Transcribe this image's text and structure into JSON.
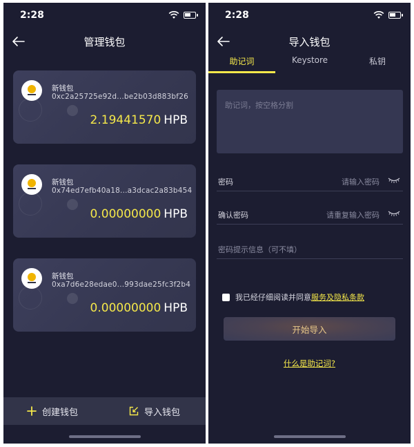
{
  "status_bar": {
    "time": "2:28"
  },
  "left_screen": {
    "title": "管理钱包",
    "wallets": [
      {
        "name": "新钱包",
        "address": "0xc2a25725e92d...be2b03d883bf26",
        "balance": "2.19441570",
        "unit": "HPB"
      },
      {
        "name": "新钱包",
        "address": "0x74ed7efb40a18...a3dcac2a83b454",
        "balance": "0.00000000",
        "unit": "HPB"
      },
      {
        "name": "新钱包",
        "address": "0xa7d6e28edae0...993dae25fc3f2b4",
        "balance": "0.00000000",
        "unit": "HPB"
      }
    ],
    "bottom_bar": {
      "create_label": "创建钱包",
      "import_label": "导入钱包"
    }
  },
  "right_screen": {
    "title": "导入钱包",
    "tabs": [
      {
        "label": "助记词",
        "active": true
      },
      {
        "label": "Keystore",
        "active": false
      },
      {
        "label": "私钥",
        "active": false
      }
    ],
    "mnemonic_placeholder": "助记词，按空格分割",
    "password": {
      "label": "密码",
      "placeholder": "请输入密码"
    },
    "confirm_password": {
      "label": "确认密码",
      "placeholder": "请重复输入密码"
    },
    "password_hint": {
      "placeholder": "密码提示信息（可不填）"
    },
    "agree_text": "我已经仔细阅读并同意",
    "terms_link": "服务及隐私条款",
    "start_button": "开始导入",
    "help_link": "什么是助记词?"
  },
  "colors": {
    "background": "#1c1d31",
    "accent": "#f5e84a",
    "card": "#3a3c58"
  }
}
